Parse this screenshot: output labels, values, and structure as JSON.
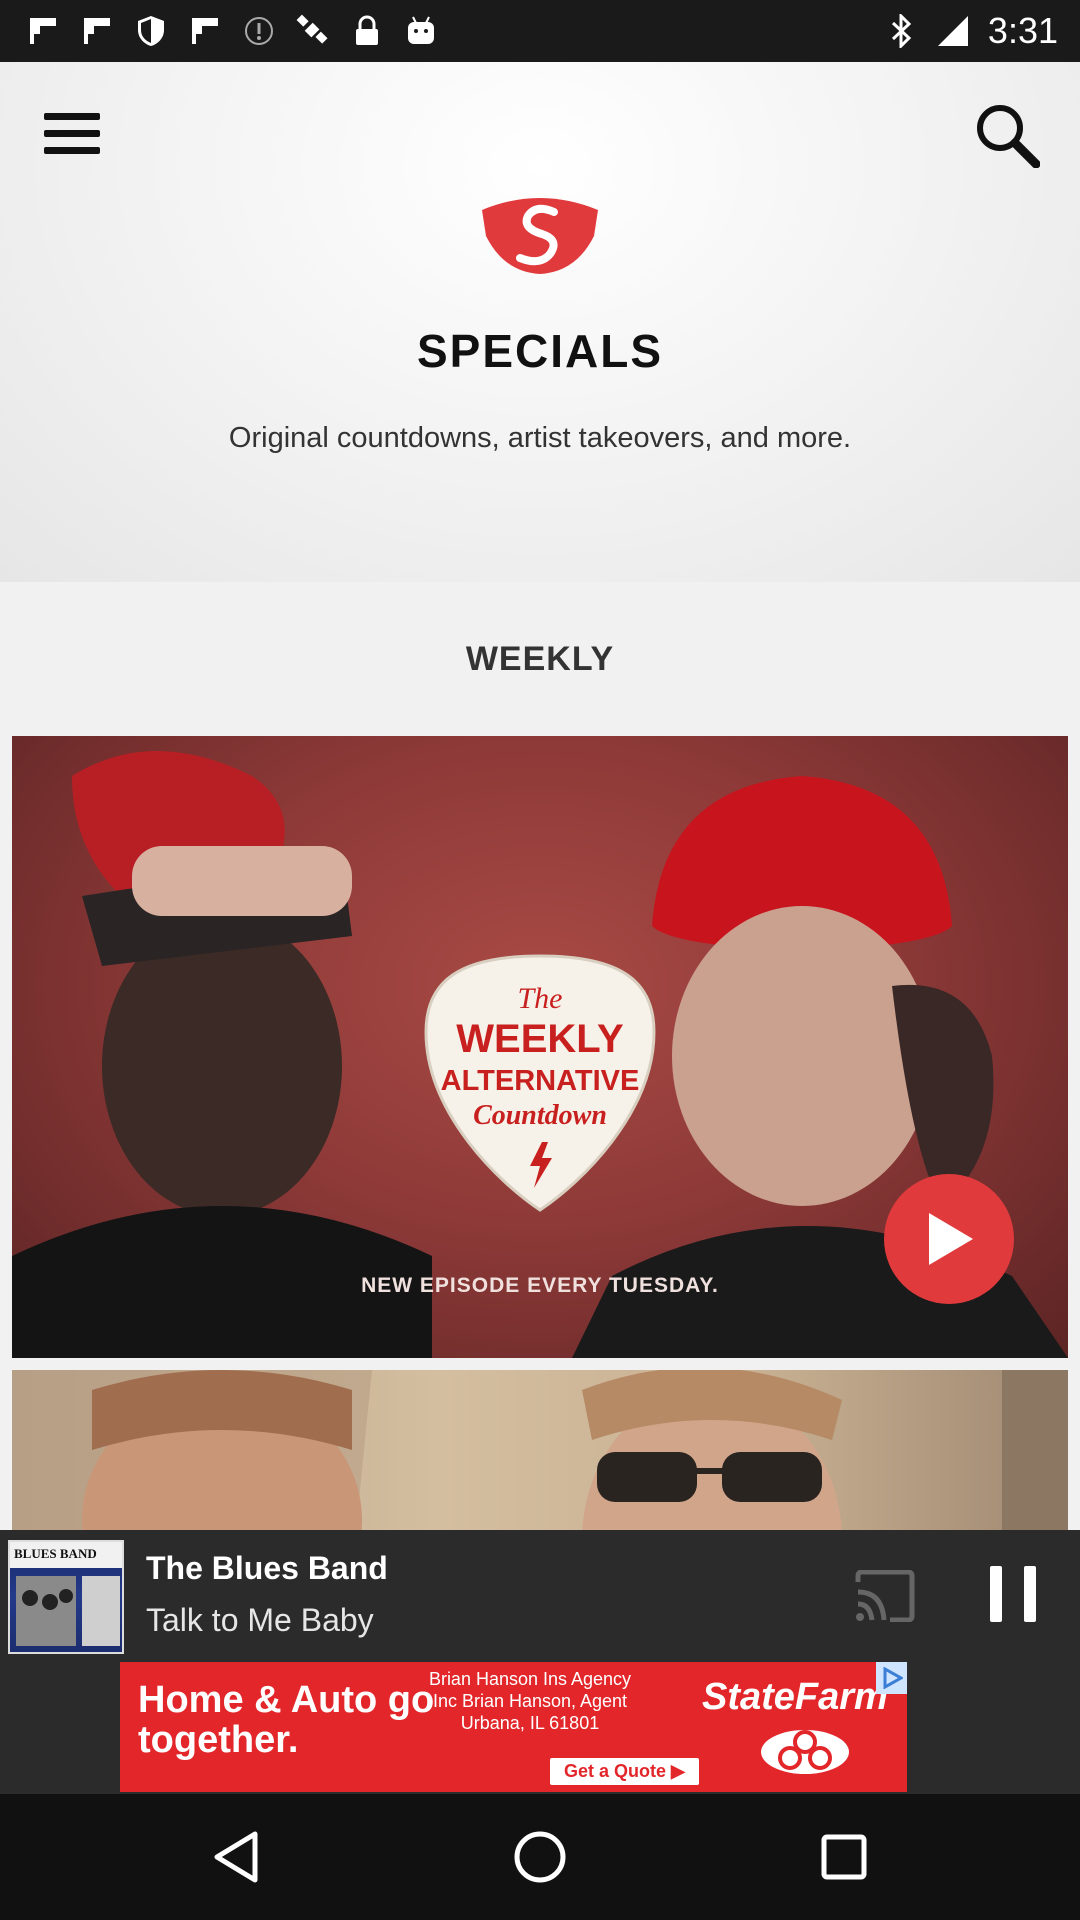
{
  "status_bar": {
    "time": "3:31",
    "left_icons": [
      "flipboard-icon",
      "flipboard-icon",
      "shield-icon",
      "flipboard-icon",
      "info-icon",
      "satellite-icon",
      "lock-icon",
      "android-icon"
    ],
    "right_icons": [
      "bluetooth-icon",
      "signal-icon"
    ]
  },
  "header": {
    "menu_icon": "menu-icon",
    "search_icon": "search-icon",
    "title": "SPECIALS",
    "subtitle": "Original countdowns, artist takeovers, and more."
  },
  "sections": [
    {
      "title": "WEEKLY",
      "cards": [
        {
          "logo_lines": [
            "The",
            "WEEKLY",
            "ALTERNATIVE",
            "Countdown"
          ],
          "caption": "NEW EPISODE EVERY TUESDAY.",
          "play_icon": "play-icon"
        },
        {
          "caption": ""
        }
      ]
    }
  ],
  "player": {
    "album_label": "BLUES BAND",
    "artist": "The Blues Band",
    "track": "Talk to Me Baby",
    "cast_icon": "cast-icon",
    "pause_icon": "pause-icon"
  },
  "ad": {
    "headline": "Home & Auto go together.",
    "agency": "Brian Hanson Ins Agency Inc Brian Hanson, Agent Urbana, IL 61801",
    "cta": "Get a Quote ▶",
    "brand": "StateFarm"
  },
  "nav": {
    "back_icon": "back-icon",
    "home_icon": "home-icon",
    "recents_icon": "recents-icon"
  },
  "colors": {
    "accent_red": "#e13a3c",
    "background": "#f1f1f1",
    "player_bg": "#2b2b2b"
  }
}
